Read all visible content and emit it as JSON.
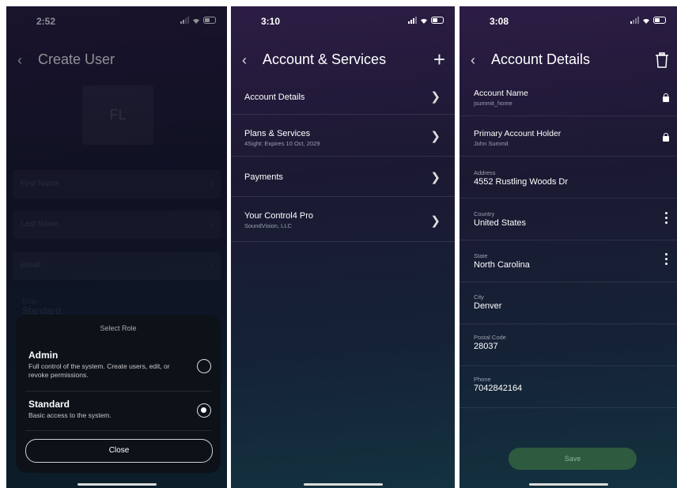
{
  "panel1": {
    "status_time": "2:52",
    "title": "Create User",
    "avatar_initials": "FL",
    "fields": [
      "First Name",
      "Last Name",
      "Email"
    ],
    "role_label": "Role",
    "role_value": "Standard",
    "sheet": {
      "title": "Select Role",
      "options": [
        {
          "name": "Admin",
          "desc": "Full control of the system. Create users, edit, or revoke permissions.",
          "selected": false
        },
        {
          "name": "Standard",
          "desc": "Basic access to the system.",
          "selected": true
        }
      ],
      "close_label": "Close"
    }
  },
  "panel2": {
    "status_time": "3:10",
    "title": "Account & Services",
    "rows": [
      {
        "label": "Account Details",
        "sub": ""
      },
      {
        "label": "Plans & Services",
        "sub": "4Sight: Expires 10 Oct, 2029"
      },
      {
        "label": "Payments",
        "sub": ""
      },
      {
        "label": "Your Control4 Pro",
        "sub": "SoundVision, LLC"
      }
    ]
  },
  "panel3": {
    "status_time": "3:08",
    "title": "Account Details",
    "locked_rows": [
      {
        "label": "Account Name",
        "value": "jsummit_home"
      },
      {
        "label": "Primary Account Holder",
        "value": "John Summit"
      }
    ],
    "fields": [
      {
        "label": "Address",
        "value": "4552 Rustling Woods Dr",
        "menu": false
      },
      {
        "label": "Country",
        "value": "United States",
        "menu": true
      },
      {
        "label": "State",
        "value": "North Carolina",
        "menu": true
      },
      {
        "label": "City",
        "value": "Denver",
        "menu": false
      },
      {
        "label": "Postal Code",
        "value": "28037",
        "menu": false
      },
      {
        "label": "Phone",
        "value": "7042842164",
        "menu": false
      }
    ],
    "save_label": "Save"
  }
}
